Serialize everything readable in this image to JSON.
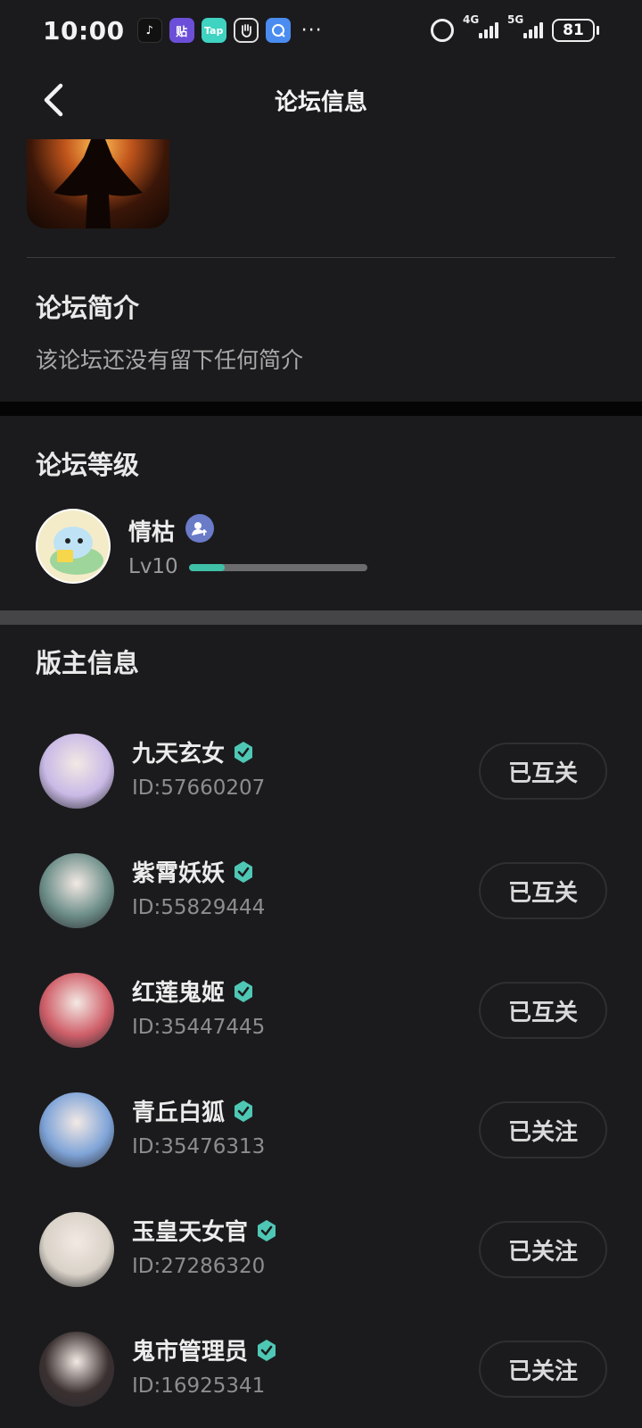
{
  "status_bar": {
    "time": "10:00",
    "app_icons": [
      "tiktok-icon",
      "tieba-icon",
      "taptap-icon",
      "hand-icon",
      "qq-browser-icon"
    ],
    "more": "···",
    "net1": "4G",
    "net2": "5G",
    "battery": "81"
  },
  "header": {
    "title": "论坛信息"
  },
  "intro": {
    "heading": "论坛简介",
    "text": "该论坛还没有留下任何简介"
  },
  "level": {
    "heading": "论坛等级",
    "user_name": "情枯",
    "level_label": "Lv10",
    "progress_fraction": 0.2
  },
  "moderators": {
    "heading": "版主信息",
    "items": [
      {
        "name": "九天玄女",
        "id": "ID:57660207",
        "button": "已互关",
        "avatar_color": "#c9b9e6"
      },
      {
        "name": "紫霄妖妖",
        "id": "ID:55829444",
        "button": "已互关",
        "avatar_color": "#6e8f8a"
      },
      {
        "name": "红莲鬼姬",
        "id": "ID:35447445",
        "button": "已互关",
        "avatar_color": "#d0606a"
      },
      {
        "name": "青丘白狐",
        "id": "ID:35476313",
        "button": "已关注",
        "avatar_color": "#7fa4d8"
      },
      {
        "name": "玉皇天女官",
        "id": "ID:27286320",
        "button": "已关注",
        "avatar_color": "#d9d2c8"
      },
      {
        "name": "鬼市管理员",
        "id": "ID:16925341",
        "button": "已关注",
        "avatar_color": "#3a3030"
      }
    ]
  },
  "colors": {
    "background": "#1b1b1d",
    "accent": "#3fc0a8",
    "verify": "#4fc7b5"
  }
}
